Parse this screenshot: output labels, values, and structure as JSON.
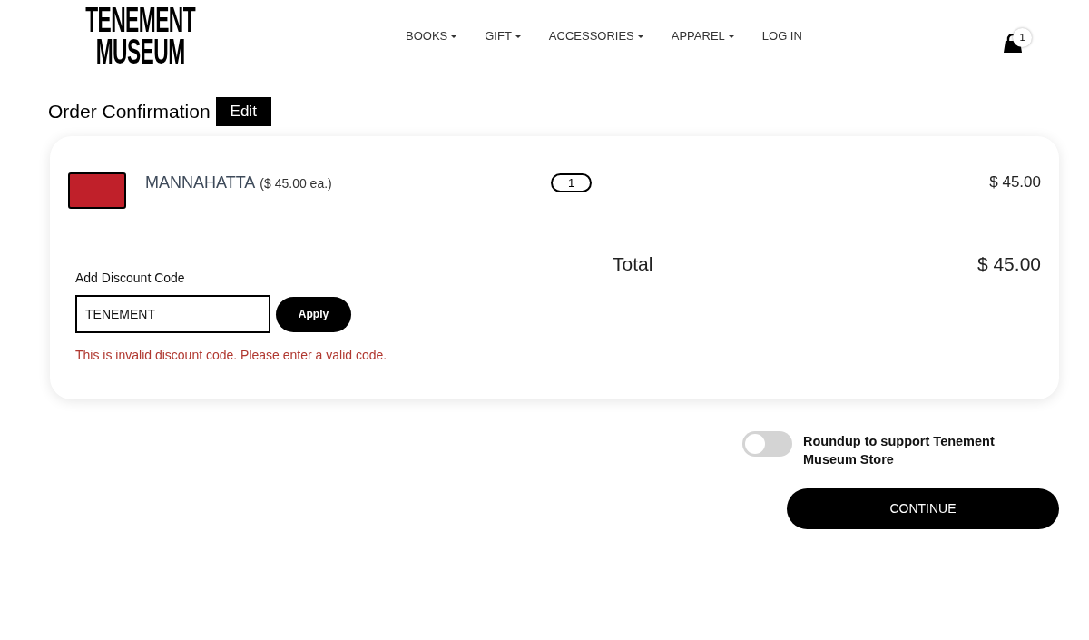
{
  "header": {
    "logo": "TENEMENT MUSEUM",
    "nav": [
      {
        "label": "BOOKS",
        "has_dropdown": true
      },
      {
        "label": "GIFT",
        "has_dropdown": true
      },
      {
        "label": "ACCESSORIES",
        "has_dropdown": true
      },
      {
        "label": "APPAREL",
        "has_dropdown": true
      },
      {
        "label": "LOG IN",
        "has_dropdown": false
      }
    ],
    "cart": {
      "count": "1"
    }
  },
  "page_title": "Order Confirmation",
  "edit_button": "Edit",
  "order": {
    "items": [
      {
        "name": "MANNAHATTA",
        "unit_price": "($ 45.00 ea.)",
        "quantity": "1",
        "price": "$ 45.00"
      }
    ],
    "discount": {
      "label": "Add Discount Code",
      "value": "TENEMENT",
      "button": "Apply",
      "error": "This is invalid discount code. Please enter a valid code."
    },
    "total_label": "Total",
    "total": "$ 45.00"
  },
  "roundup": {
    "on": false,
    "label": "Roundup to support Tenement Museum Store"
  },
  "continue_button": "CONTINUE"
}
